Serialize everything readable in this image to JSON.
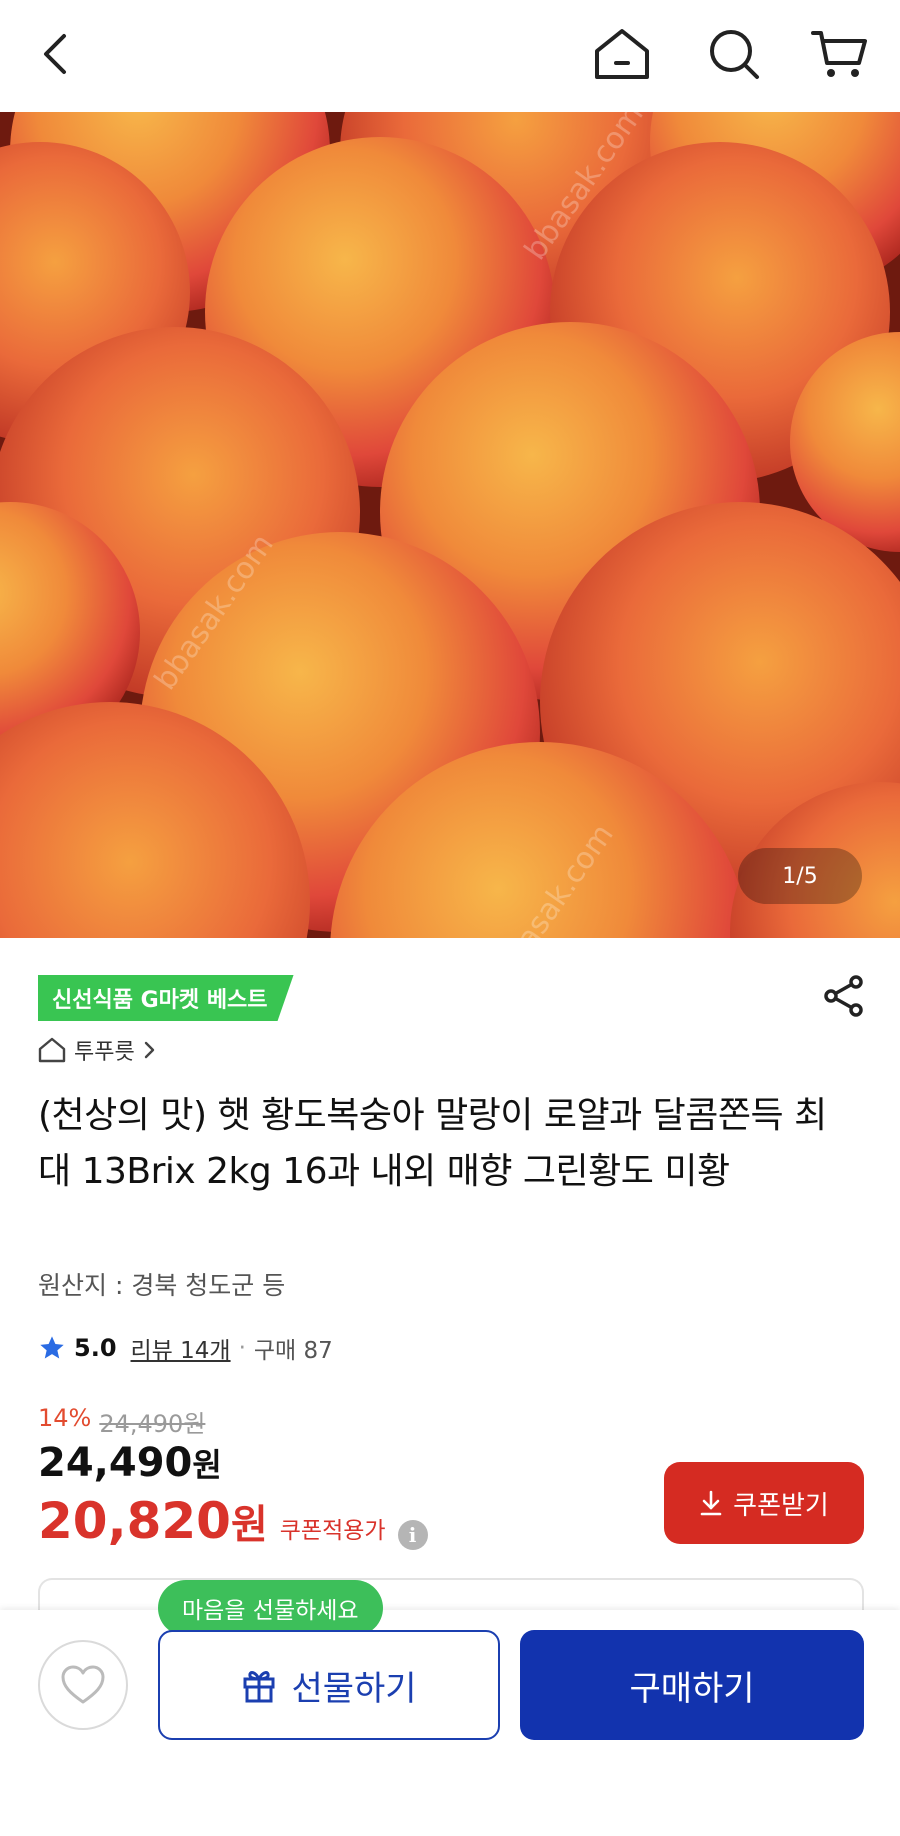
{
  "nav": {
    "back_icon": "chevron-left-icon",
    "home_icon": "home-icon",
    "search_icon": "search-icon",
    "cart_icon": "cart-icon"
  },
  "hero": {
    "image_counter": "1/5",
    "watermark": "bbasak.com"
  },
  "product": {
    "badge": "신선식품 G마켓 베스트",
    "store": "투푸릇",
    "title": "(천상의 맛) 햇 황도복숭아 말랑이 로얄과 달콤쫀득 최대 13Brix 2kg 16과 내외 매향 그린황도 미황",
    "origin": "원산지 : 경북 청도군 등",
    "rating": "5.0",
    "review_text": "리뷰 14개",
    "purchase_text": "구매 87",
    "discount_percent": "14%",
    "original_price": "24,490원",
    "price_number": "24,490",
    "price_unit": "원",
    "coupon_price_number": "20,820",
    "coupon_price_unit": "원",
    "coupon_label": "쿠폰적용가",
    "info_icon_glyph": "i"
  },
  "actions": {
    "coupon_button": "쿠폰받기",
    "gift_tooltip": "마음을 선물하세요",
    "gift_button": "선물하기",
    "buy_button": "구매하기"
  },
  "colors": {
    "badge_green": "#39c552",
    "price_red": "#d9332b",
    "coupon_button_red": "#d52b22",
    "primary_blue": "#1233ae"
  }
}
